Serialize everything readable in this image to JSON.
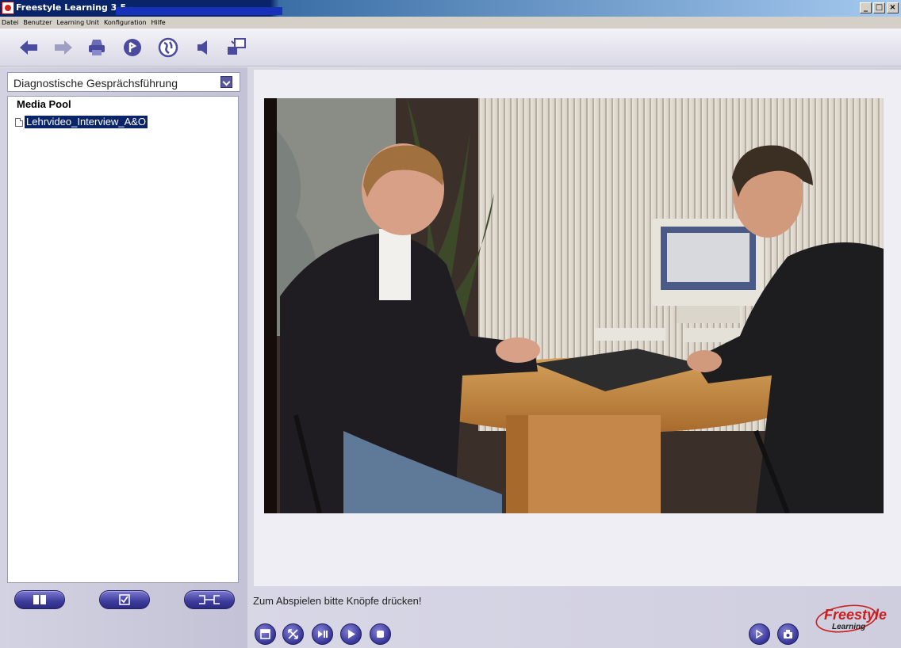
{
  "window": {
    "title": "Freestyle Learning 3.5 -",
    "controls": [
      "_",
      "□",
      "×"
    ]
  },
  "menu": [
    "Datei",
    "Benutzer",
    "Learning Unit",
    "Konfiguration",
    "Hilfe"
  ],
  "toolbar": {
    "icons": [
      "arrow-left-icon",
      "arrow-right-icon",
      "printer-icon",
      "info-icon",
      "globe-icon",
      "speaker-icon",
      "window-switch-icon"
    ]
  },
  "sidebar": {
    "selector_value": "Diagnostische Gesprächsführung",
    "tree_title": "Media Pool",
    "tree_items": [
      "Lehrvideo_Interview_A&O"
    ],
    "bottom_buttons": [
      "book-icon",
      "checkbox-icon",
      "link-icon"
    ]
  },
  "main": {
    "status": "Zum Abspielen bitte Knöpfe drücken!",
    "player_buttons": [
      "window-icon",
      "fullscreen-icon",
      "step-forward-icon",
      "play-icon",
      "stop-icon"
    ],
    "right_buttons": [
      "next-icon",
      "snapshot-icon"
    ],
    "logo_text": "Freestyle",
    "logo_sub": "Learning"
  },
  "colors": {
    "accent": "#3e3c9b",
    "selection": "#0a246a",
    "logo_red": "#c8201f"
  }
}
